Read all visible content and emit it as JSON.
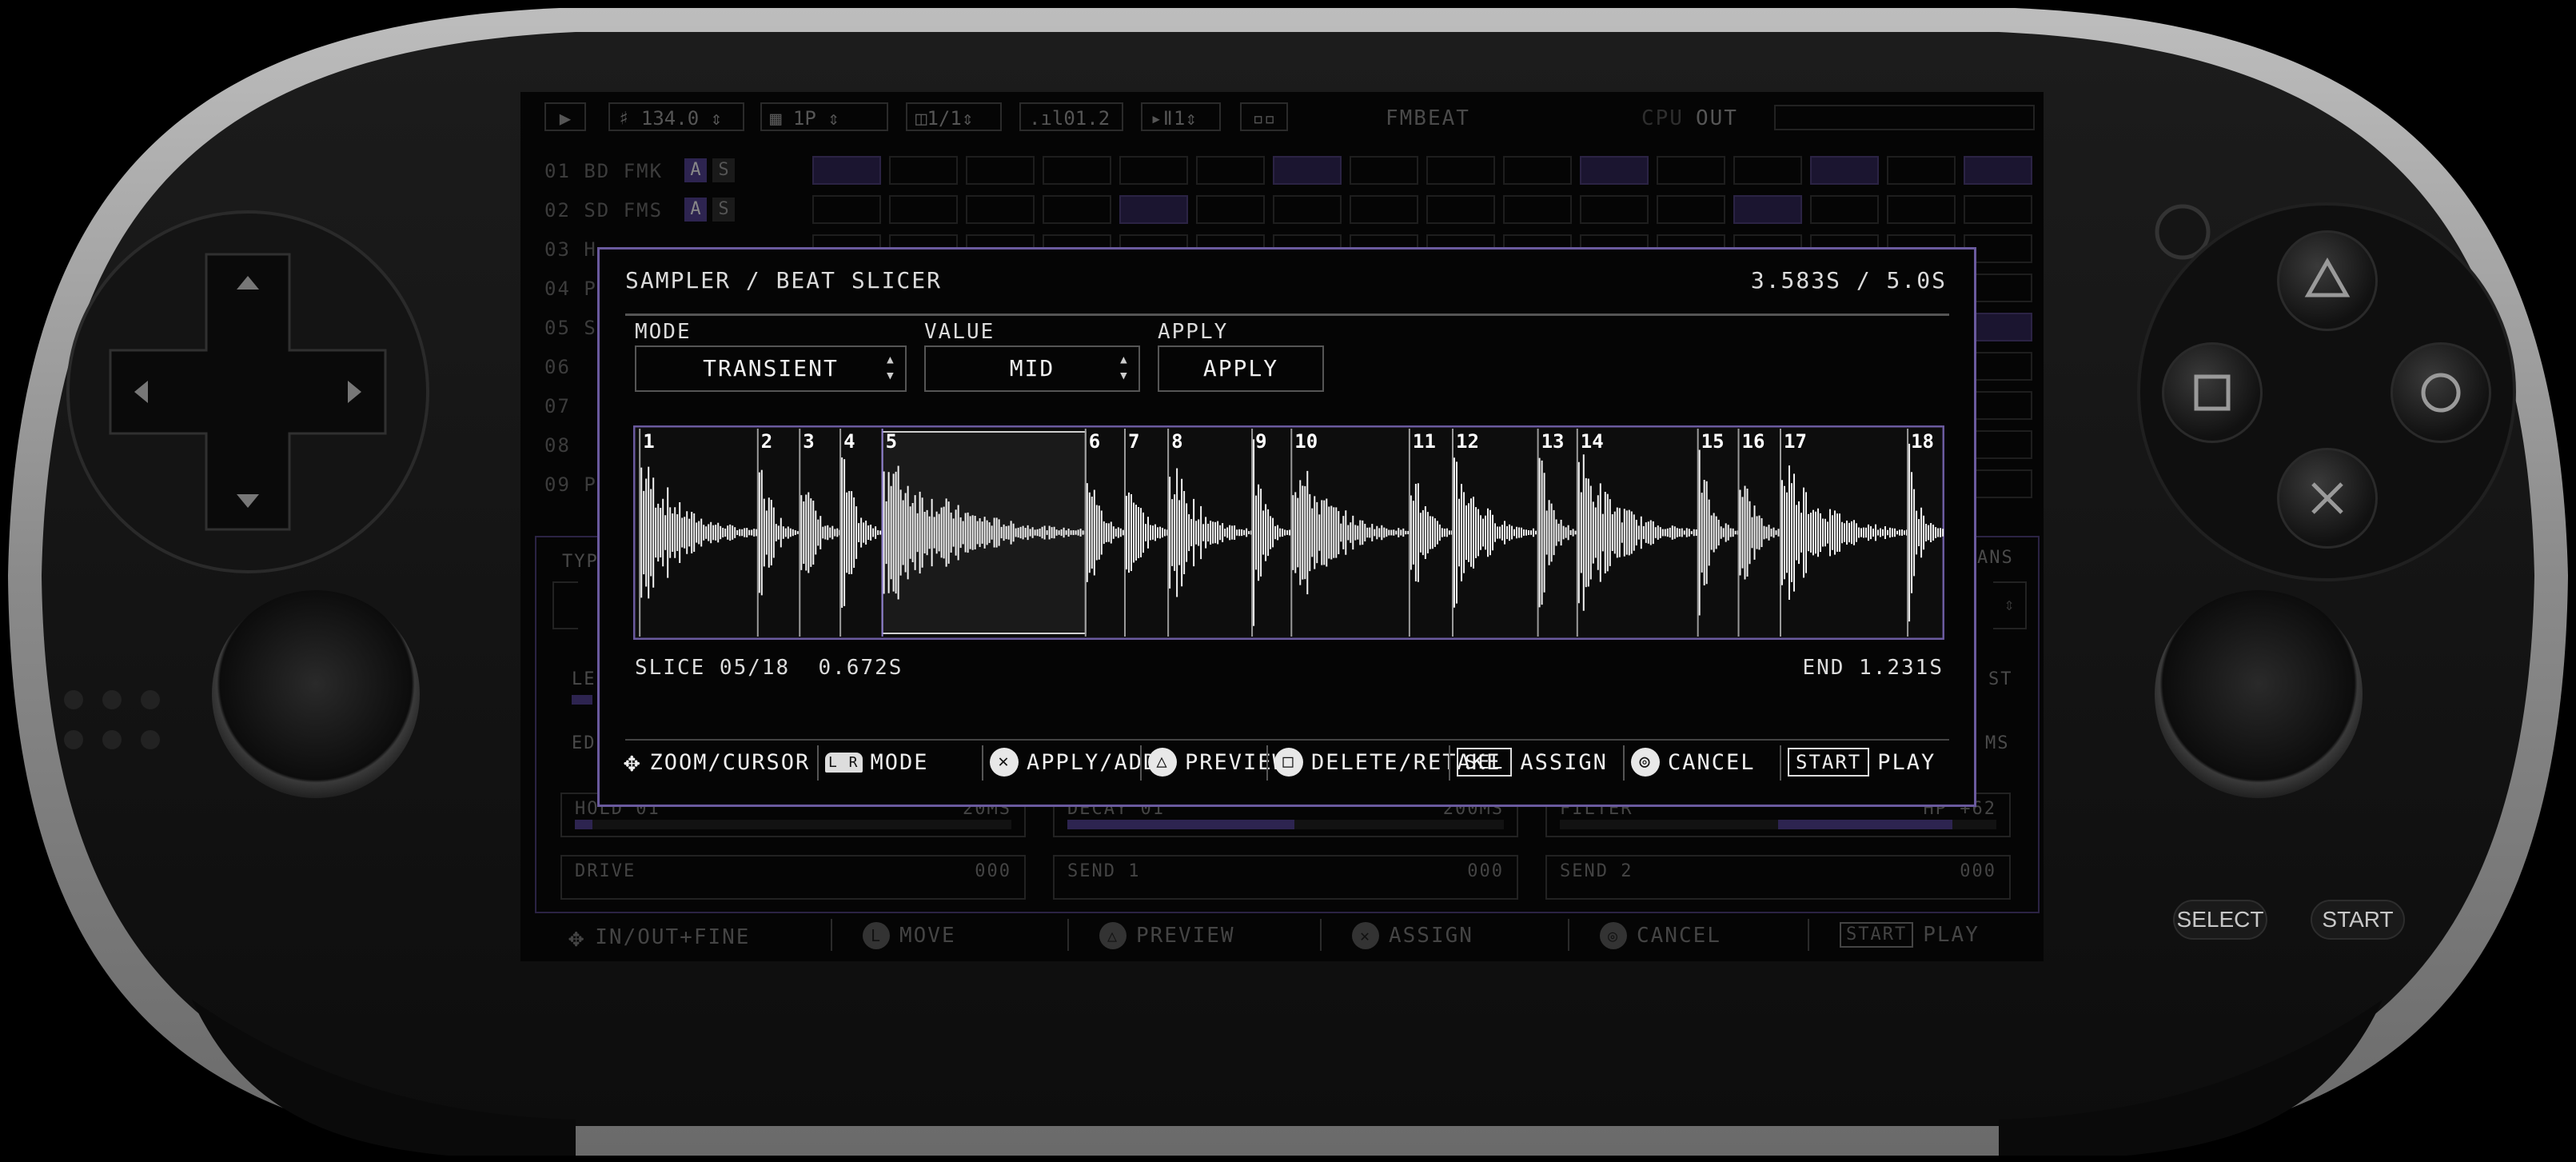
{
  "device": {
    "buttons": {
      "select": "SELECT",
      "start": "START"
    }
  },
  "toolbar": {
    "tempo": "134.0",
    "pattern": "1P",
    "fraction": "1/1",
    "level": "01.2",
    "step": "1",
    "app_name": "FMBEAT",
    "cpu_label": "CPU",
    "out_label": "OUT"
  },
  "tracks": [
    {
      "label": "01 BD FMK",
      "a": "A",
      "s": "S"
    },
    {
      "label": "02 SD FMS",
      "a": "A",
      "s": "S"
    },
    {
      "label": "03 H",
      "a": "",
      "s": ""
    },
    {
      "label": "04 P",
      "a": "",
      "s": ""
    },
    {
      "label": "05 S",
      "a": "",
      "s": ""
    },
    {
      "label": "06",
      "a": "",
      "s": ""
    },
    {
      "label": "07",
      "a": "",
      "s": ""
    },
    {
      "label": "08",
      "a": "",
      "s": ""
    },
    {
      "label": "09 P",
      "a": "",
      "s": ""
    }
  ],
  "params": {
    "typ": "TYP",
    "ans": "ANS",
    "le": "LE",
    "st": "ST",
    "ed": "ED",
    "ms": "MS",
    "hold": {
      "label": "HOLD 01",
      "value": "20MS"
    },
    "decay": {
      "label": "DECAY 01",
      "value": "200MS",
      "level": 0.52
    },
    "filter": {
      "label": "FILTER",
      "value": "HP +62",
      "level": 0.4
    },
    "drive": {
      "label": "DRIVE",
      "value": "000"
    },
    "send1": {
      "label": "SEND 1",
      "value": "000"
    },
    "send2": {
      "label": "SEND 2",
      "value": "000"
    }
  },
  "bottom_hints": [
    {
      "icon": "dpad-icon",
      "label": "IN/OUT+FINE"
    },
    {
      "icon": "l-button-icon",
      "glyph": "L",
      "label": "MOVE"
    },
    {
      "icon": "triangle-icon",
      "glyph": "△",
      "label": "PREVIEW"
    },
    {
      "icon": "cross-icon",
      "glyph": "✕",
      "label": "ASSIGN"
    },
    {
      "icon": "circle-icon",
      "glyph": "◎",
      "label": "CANCEL"
    },
    {
      "icon": "start-icon",
      "glyph": "START",
      "label": "PLAY"
    }
  ],
  "modal": {
    "title": "SAMPLER / BEAT SLICER",
    "time": "3.583S / 5.0S",
    "mode_label": "MODE",
    "mode_value": "TRANSIENT",
    "value_label": "VALUE",
    "value_value": "MID",
    "apply_label": "APPLY",
    "apply_button": "APPLY",
    "slice_info": "SLICE 05/18",
    "slice_time": "0.672S",
    "end_info": "END 1.231S",
    "selected_slice": 5,
    "slice_markers": [
      "1",
      "2",
      "3",
      "4",
      "5",
      "6",
      "7",
      "8",
      "9",
      "10",
      "11",
      "12",
      "13",
      "14",
      "15",
      "16",
      "17",
      "18"
    ],
    "hints": [
      {
        "icon": "dpad-icon",
        "label": "ZOOM/CURSOR"
      },
      {
        "icon": "lr-icon",
        "glyph": "L R",
        "label": "MODE"
      },
      {
        "icon": "cross-icon",
        "glyph": "✕",
        "label": "APPLY/ADD"
      },
      {
        "icon": "triangle-icon",
        "glyph": "△",
        "label": "PREVIEW"
      },
      {
        "icon": "square-icon",
        "glyph": "□",
        "label": "DELETE/RETAKE"
      },
      {
        "icon": "select-icon",
        "glyph": "SEL",
        "label": "ASSIGN"
      },
      {
        "icon": "circle-icon",
        "glyph": "◎",
        "label": "CANCEL"
      },
      {
        "icon": "start-icon",
        "glyph": "START",
        "label": "PLAY"
      }
    ]
  },
  "colors": {
    "accent": "#6a5a9e",
    "waveform": "#f2f2f2",
    "dim_purple": "#2d2450"
  }
}
